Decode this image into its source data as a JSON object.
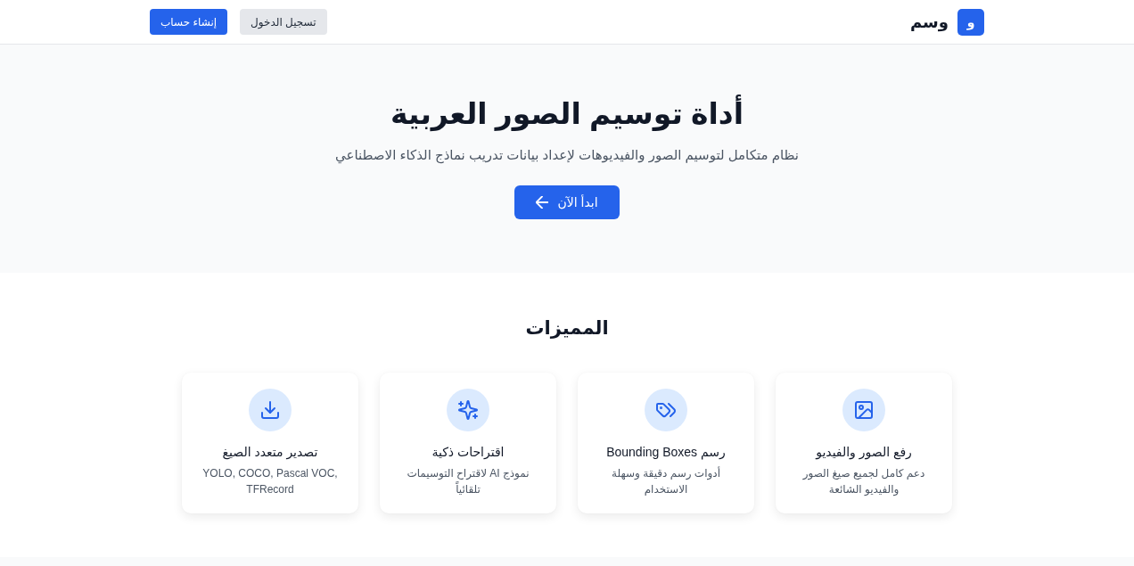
{
  "header": {
    "logo": {
      "mark": "و",
      "name": "وسم"
    },
    "buttons": [
      {
        "label": "تسجيل الدخول",
        "kind": "secondary"
      },
      {
        "label": "إنشاء حساب",
        "kind": "primary"
      }
    ]
  },
  "hero": {
    "title": "أداة توسيم الصور العربية",
    "subtitle": "نظام متكامل لتوسيم الصور والفيديوهات لإعداد بيانات تدريب نماذج الذكاء الاصطناعي",
    "button": "ابدأ الآن"
  },
  "features": {
    "title": "المميزات",
    "items": [
      {
        "title": "رفع الصور والفيديو",
        "description": "دعم كامل لجميع صيغ الصور والفيديو الشائعة"
      },
      {
        "title": "رسم Bounding Boxes",
        "description": "أدوات رسم دقيقة وسهلة الاستخدام"
      },
      {
        "title": "اقتراحات ذكية",
        "description": "نموذج AI لاقتراح التوسيمات تلقائياً"
      },
      {
        "title": "تصدير متعدد الصيغ",
        "description": "YOLO, COCO, Pascal VOC, TFRecord"
      }
    ]
  }
}
